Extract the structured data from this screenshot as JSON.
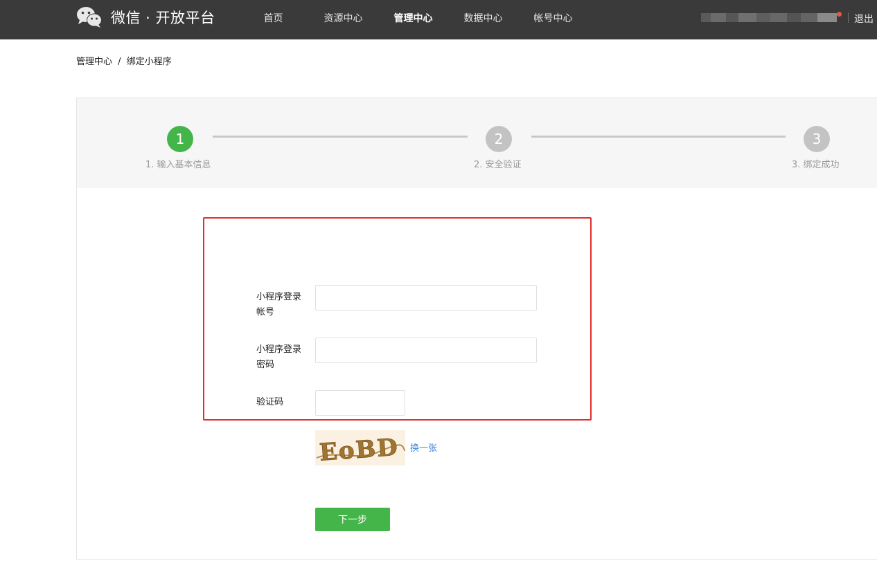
{
  "header": {
    "brand": "微信 · 开放平台",
    "logo_icon": "wechat-logo-icon",
    "nav": [
      {
        "label": "首页",
        "active": false
      },
      {
        "label": "资源中心",
        "active": false
      },
      {
        "label": "管理中心",
        "active": true
      },
      {
        "label": "数据中心",
        "active": false
      },
      {
        "label": "帐号中心",
        "active": false
      }
    ],
    "logout_label": "退出"
  },
  "breadcrumb": {
    "parent": "管理中心",
    "separator": "/",
    "current": "绑定小程序"
  },
  "steps": [
    {
      "number": "1",
      "label": "1. 输入基本信息",
      "state": "active"
    },
    {
      "number": "2",
      "label": "2. 安全验证",
      "state": "todo"
    },
    {
      "number": "3",
      "label": "3. 绑定成功",
      "state": "todo"
    }
  ],
  "form": {
    "account_label": "小程序登录帐号",
    "account_value": "",
    "password_label": "小程序登录密码",
    "password_value": "",
    "captcha_label": "验证码",
    "captcha_value": "",
    "captcha_image_text": "EoBD",
    "captcha_refresh_label": "换一张",
    "submit_label": "下一步"
  },
  "colors": {
    "topbar": "#3a3a3a",
    "accent_green": "#44b549",
    "step_inactive": "#c3c3c3",
    "highlight_red": "#e02d2d",
    "link_blue": "#3b87d8"
  }
}
